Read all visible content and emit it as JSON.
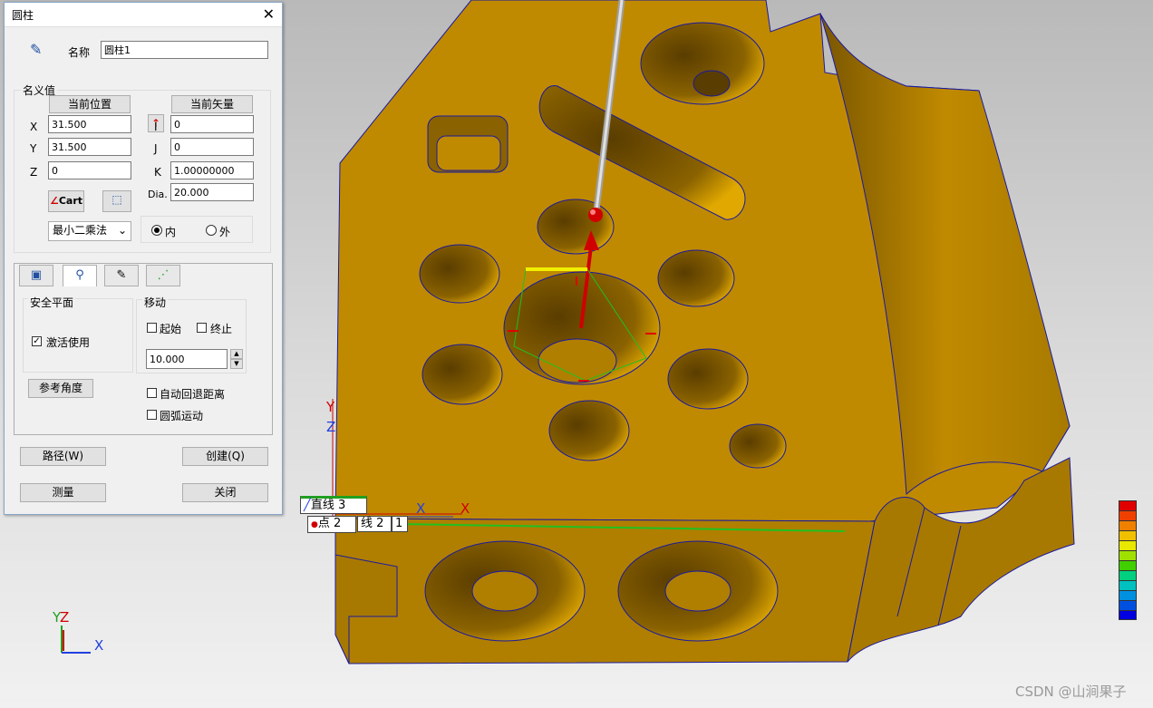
{
  "dialog": {
    "title": "圆柱",
    "name_label": "名称",
    "name_value": "圆柱1",
    "nominal_group": "名义值",
    "current_position_btn": "当前位置",
    "current_vector_btn": "当前矢量",
    "coords": [
      {
        "label": "X",
        "value": "31.500"
      },
      {
        "label": "Y",
        "value": "31.500"
      },
      {
        "label": "Z",
        "value": "0"
      }
    ],
    "vectors": [
      {
        "label": "I",
        "value": "0"
      },
      {
        "label": "J",
        "value": "0"
      },
      {
        "label": "K",
        "value": "1.00000000"
      },
      {
        "label": "Dia.",
        "value": "20.000"
      }
    ],
    "cart_btn": "Cart",
    "method_value": "最小二乘法",
    "radio_in": "内",
    "radio_out": "外",
    "safety_plane": "安全平面",
    "activate_label": "激活使用",
    "move_group": "移动",
    "start_label": "起始",
    "end_label": "终止",
    "move_value": "10.000",
    "ref_angle_btn": "参考角度",
    "auto_retract_label": "自动回退距离",
    "arc_motion_label": "圆弧运动",
    "path_btn": "路径(W)",
    "create_btn": "创建(Q)",
    "measure_btn": "测量",
    "close_btn": "关闭"
  },
  "viewport": {
    "tag_line3": "直线 3",
    "tag_point2": "点 2",
    "tag_line2": "线 2",
    "tag_num": "1",
    "axis_x": "X",
    "axis_y": "Y",
    "axis_z": "Z",
    "watermark": "CSDN @山涧果子"
  },
  "colors": {
    "part": "#c08a00",
    "part_dark": "#8a6200",
    "edge": "#1a1aa0",
    "probe": "#d0d0d0",
    "scale": [
      "#e00000",
      "#f04000",
      "#f08000",
      "#f0c000",
      "#e8e800",
      "#a0e000",
      "#40d000",
      "#00d080",
      "#00c0c0",
      "#0090e0",
      "#0050e0",
      "#0000e0"
    ]
  }
}
